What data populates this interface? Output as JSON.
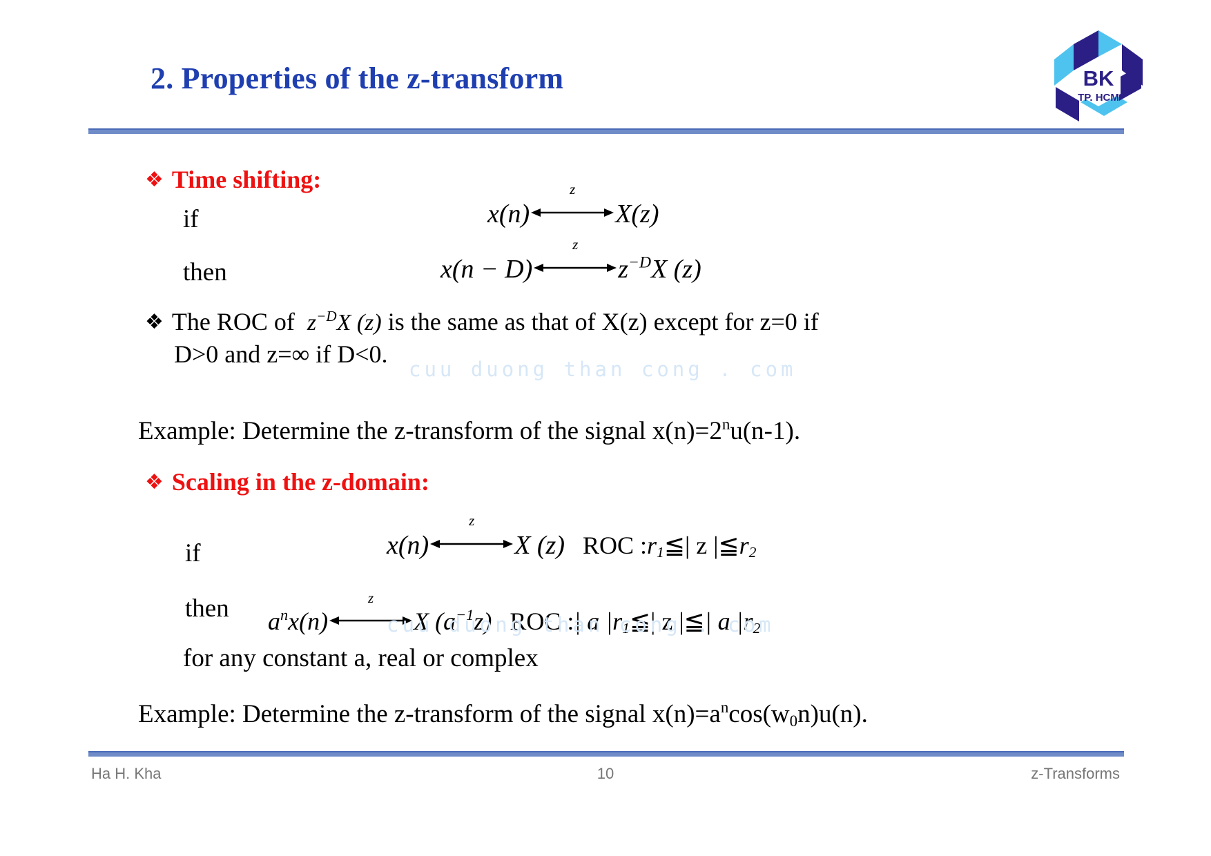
{
  "slide": {
    "title": "2. Properties of the z-transform",
    "title_color": "#1f3fb0",
    "accent_rule_color": "#6f8cc9",
    "heading_color": "#ee1111",
    "watermark": "cuu duong than cong . com",
    "watermark_color": "#d6e7f7"
  },
  "logo": {
    "name": "bk-tphcm-logo",
    "text_main": "BK",
    "text_sub": "TP. HCM",
    "color_dark": "#2b1f86",
    "color_light": "#4fc3ef"
  },
  "sections": [
    {
      "bullet": "❖",
      "heading": "Time shifting:",
      "style": "red",
      "if_label": "if",
      "then_label": "then",
      "eq_if": {
        "lhs": "x(n)",
        "arrow_label": "z",
        "rhs": "X(z)"
      },
      "eq_then": {
        "lhs": "x(n − D)",
        "arrow_label": "z",
        "rhs_base": "z",
        "rhs_exp": "−D",
        "rhs_tail": "X (z)"
      }
    },
    {
      "bullet": "❖",
      "heading": "Scaling in the z-domain:",
      "style": "red",
      "if_label": "if",
      "then_label": "then",
      "eq_if": {
        "lhs": "x(n)",
        "arrow_label": "z",
        "rhs": "X (z)",
        "roc_prefix": "ROC :",
        "roc_lo": "r",
        "roc_lo_sub": "1",
        "roc_mid": "≦| z |≦",
        "roc_hi": "r",
        "roc_hi_sub": "2"
      },
      "eq_then": {
        "lhs_base": "a",
        "lhs_exp": "n",
        "lhs_tail": "x(n)",
        "arrow_label": "z",
        "rhs": "X (a",
        "rhs_exp": "−1",
        "rhs_tail": "z)",
        "roc_prefix": "ROC :",
        "roc_a1": "| a |",
        "roc_lo": "r",
        "roc_lo_sub": "1",
        "roc_mid": "≦| z |≦",
        "roc_a2": "| a |",
        "roc_hi": "r",
        "roc_hi_sub": "2"
      },
      "note": "for any constant a, real or complex"
    }
  ],
  "roc_paragraph": {
    "bullet": "❖",
    "part1": "The ROC of",
    "math_base": "z",
    "math_exp": "−D",
    "math_tail": "X (z)",
    "part2": "is the same as that of  X(z) except for z=0 if",
    "line2": "D>0 and z=∞ if  D<0."
  },
  "examples": [
    {
      "prefix": "Example: Determine the z-transform of  the signal x(n)=2",
      "sup": "n",
      "suffix": "u(n-1)."
    },
    {
      "prefix": "Example: Determine the z-transform of  the signal x(n)=a",
      "sup": "n",
      "mid": "cos(w",
      "sub": "0",
      "suffix": "n)u(n)."
    }
  ],
  "footer": {
    "author": "Ha H. Kha",
    "page": "10",
    "topic": "z-Transforms"
  }
}
